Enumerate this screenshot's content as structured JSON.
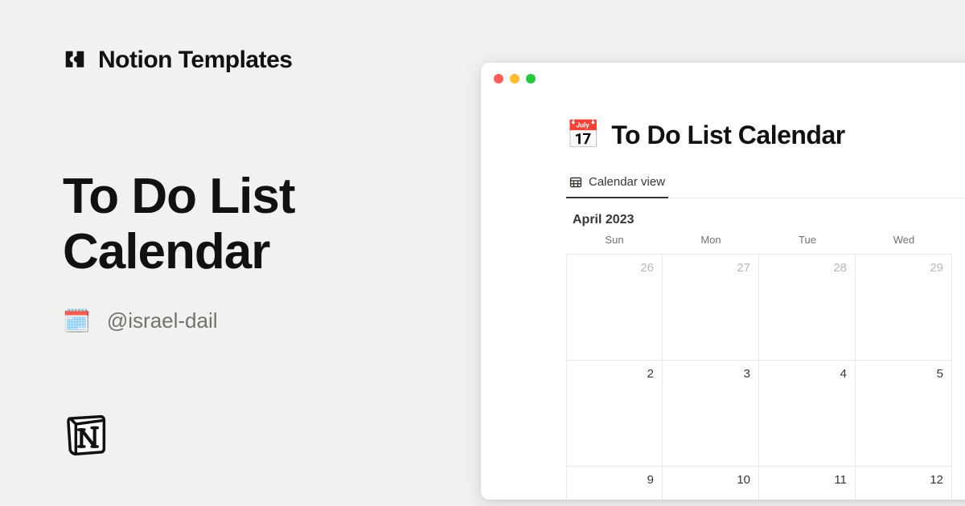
{
  "header": {
    "title": "Notion Templates"
  },
  "page": {
    "title": "To Do List Calendar",
    "author_emoji": "🗓️",
    "author_handle": "@israel-dail"
  },
  "window": {
    "doc_emoji": "📅",
    "doc_title": "To Do List Calendar",
    "view_tab_label": "Calendar view",
    "month_label": "April 2023",
    "day_headers": [
      "Sun",
      "Mon",
      "Tue",
      "Wed"
    ],
    "rows": [
      {
        "dim": true,
        "days": [
          "26",
          "27",
          "28",
          "29"
        ]
      },
      {
        "dim": false,
        "days": [
          "2",
          "3",
          "4",
          "5"
        ]
      },
      {
        "dim": false,
        "days": [
          "9",
          "10",
          "11",
          "12"
        ]
      }
    ]
  }
}
